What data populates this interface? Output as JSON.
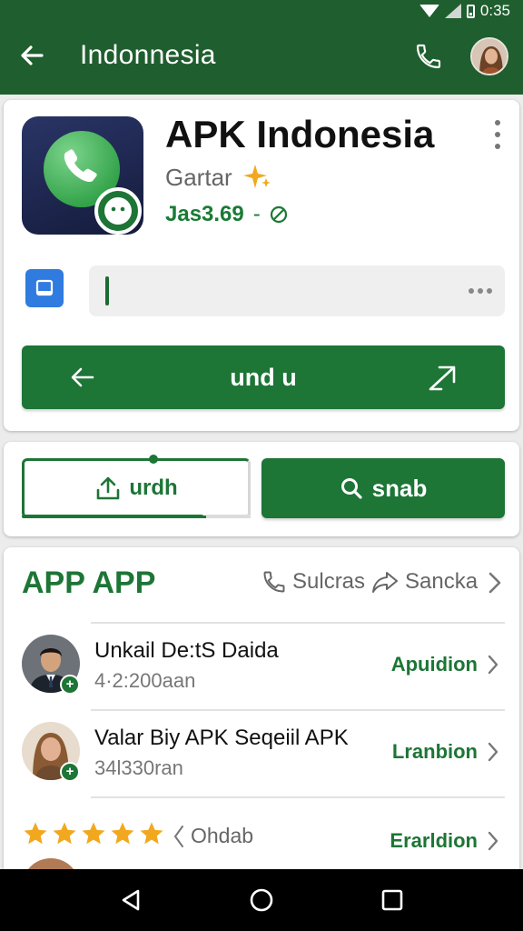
{
  "status_bar": {
    "time": "0:35"
  },
  "app_bar": {
    "title": "Indonnesia"
  },
  "app": {
    "name": "APK Indonesia",
    "developer": "Gartar",
    "price": "Jas3.69"
  },
  "primary_action": {
    "label": "und u"
  },
  "actions": {
    "outline_label": "urdh",
    "outline_progress": 0.8,
    "fill_label": "snab"
  },
  "section": {
    "title": "APP APP",
    "action_1": "Sulcras",
    "action_2": "Sancka"
  },
  "rows": [
    {
      "title": "Unkail De:tS Daida",
      "subtitle": "4·2:200aan",
      "action": "Apuidion"
    },
    {
      "title": "Valar Biy APK Seqeiil APK",
      "subtitle": "34l330ran",
      "action": "Lranbion"
    }
  ],
  "rating_row": {
    "stars": 5,
    "label": "Ohdab",
    "action": "Erarldion"
  },
  "colors": {
    "primary": "#1d7536",
    "app_bar": "#1f5e2e",
    "star": "#f2a81e"
  },
  "icons": [
    "back-arrow-icon",
    "phone-icon",
    "more-vert-icon",
    "document-icon",
    "upload-icon",
    "search-icon",
    "share-icon",
    "chevron-right-icon",
    "star-icon"
  ]
}
